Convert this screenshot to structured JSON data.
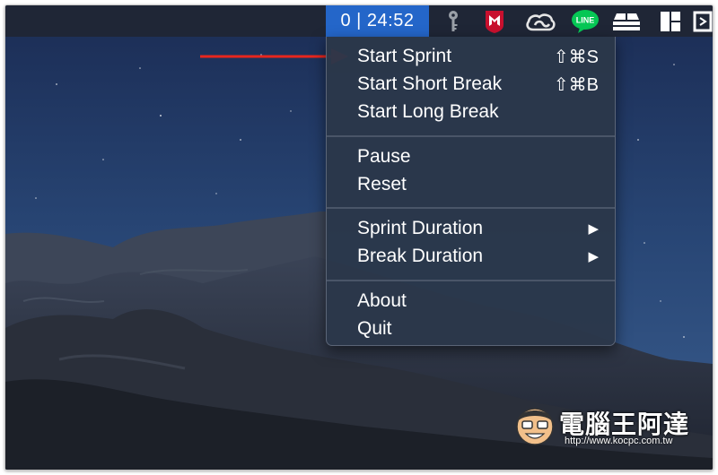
{
  "menubar": {
    "timer_text": "0 | 24:52",
    "icons": [
      "key-icon",
      "mcafee-icon",
      "creative-cloud-icon",
      "line-icon",
      "stack-icon",
      "layout-icon",
      "window-icon"
    ],
    "line_label": "LINE"
  },
  "menu": {
    "group1": [
      {
        "label": "Start Sprint",
        "shortcut": "⇧⌘S"
      },
      {
        "label": "Start Short Break",
        "shortcut": "⇧⌘B"
      },
      {
        "label": "Start Long Break",
        "shortcut": ""
      }
    ],
    "group2": [
      {
        "label": "Pause"
      },
      {
        "label": "Reset"
      }
    ],
    "group3": [
      {
        "label": "Sprint Duration",
        "arrow": "▶"
      },
      {
        "label": "Break Duration",
        "arrow": "▶"
      }
    ],
    "group4": [
      {
        "label": "About"
      },
      {
        "label": "Quit"
      }
    ]
  },
  "annotation": {
    "color": "#e8261e"
  },
  "watermark": {
    "title": "電腦王阿達",
    "url": "http://www.kocpc.com.tw"
  },
  "colors": {
    "menubar": "#1f2636",
    "timer_bg": "#2466c9",
    "menu_bg": "#2b374a"
  }
}
